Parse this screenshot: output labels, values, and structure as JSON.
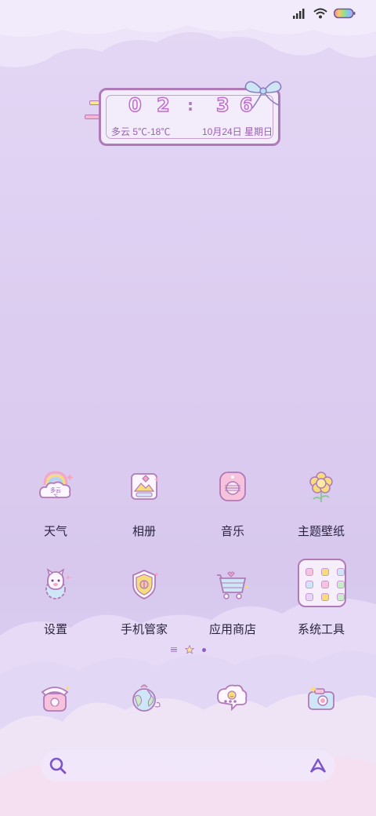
{
  "status_bar": {
    "icons": [
      "signal-icon",
      "wifi-icon",
      "battery-icon"
    ]
  },
  "widget": {
    "time_digits": [
      "0",
      "2",
      "3",
      "6"
    ],
    "colon": ":",
    "weather": "多云 5℃-18℃",
    "date": "10月24日 星期日"
  },
  "apps": [
    {
      "label": "天气",
      "icon": "weather-icon"
    },
    {
      "label": "相册",
      "icon": "gallery-icon"
    },
    {
      "label": "音乐",
      "icon": "music-icon"
    },
    {
      "label": "主题壁纸",
      "icon": "themes-icon"
    },
    {
      "label": "设置",
      "icon": "settings-icon"
    },
    {
      "label": "手机管家",
      "icon": "security-icon"
    },
    {
      "label": "应用商店",
      "icon": "app-store-icon"
    },
    {
      "label": "系统工具",
      "icon": "system-tools-folder-icon"
    }
  ],
  "weather_icon_text": "多云",
  "pager": {
    "pages": 2,
    "current_page": 1
  },
  "dock": [
    {
      "icon": "phone-icon"
    },
    {
      "icon": "browser-icon"
    },
    {
      "icon": "messages-icon"
    },
    {
      "icon": "camera-icon"
    }
  ],
  "colors": {
    "accent": "#b07ab8",
    "text": "#2b2440",
    "background": "#dccdf0"
  }
}
